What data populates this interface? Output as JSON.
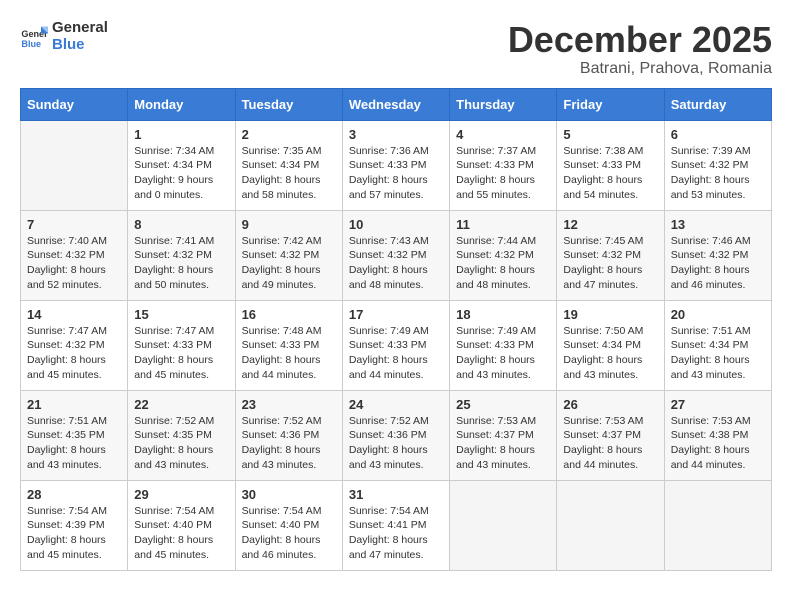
{
  "header": {
    "logo_general": "General",
    "logo_blue": "Blue",
    "month_title": "December 2025",
    "location": "Batrani, Prahova, Romania"
  },
  "days_of_week": [
    "Sunday",
    "Monday",
    "Tuesday",
    "Wednesday",
    "Thursday",
    "Friday",
    "Saturday"
  ],
  "weeks": [
    [
      {
        "day": "",
        "info": ""
      },
      {
        "day": "1",
        "info": "Sunrise: 7:34 AM\nSunset: 4:34 PM\nDaylight: 9 hours\nand 0 minutes."
      },
      {
        "day": "2",
        "info": "Sunrise: 7:35 AM\nSunset: 4:34 PM\nDaylight: 8 hours\nand 58 minutes."
      },
      {
        "day": "3",
        "info": "Sunrise: 7:36 AM\nSunset: 4:33 PM\nDaylight: 8 hours\nand 57 minutes."
      },
      {
        "day": "4",
        "info": "Sunrise: 7:37 AM\nSunset: 4:33 PM\nDaylight: 8 hours\nand 55 minutes."
      },
      {
        "day": "5",
        "info": "Sunrise: 7:38 AM\nSunset: 4:33 PM\nDaylight: 8 hours\nand 54 minutes."
      },
      {
        "day": "6",
        "info": "Sunrise: 7:39 AM\nSunset: 4:32 PM\nDaylight: 8 hours\nand 53 minutes."
      }
    ],
    [
      {
        "day": "7",
        "info": "Sunrise: 7:40 AM\nSunset: 4:32 PM\nDaylight: 8 hours\nand 52 minutes."
      },
      {
        "day": "8",
        "info": "Sunrise: 7:41 AM\nSunset: 4:32 PM\nDaylight: 8 hours\nand 50 minutes."
      },
      {
        "day": "9",
        "info": "Sunrise: 7:42 AM\nSunset: 4:32 PM\nDaylight: 8 hours\nand 49 minutes."
      },
      {
        "day": "10",
        "info": "Sunrise: 7:43 AM\nSunset: 4:32 PM\nDaylight: 8 hours\nand 48 minutes."
      },
      {
        "day": "11",
        "info": "Sunrise: 7:44 AM\nSunset: 4:32 PM\nDaylight: 8 hours\nand 48 minutes."
      },
      {
        "day": "12",
        "info": "Sunrise: 7:45 AM\nSunset: 4:32 PM\nDaylight: 8 hours\nand 47 minutes."
      },
      {
        "day": "13",
        "info": "Sunrise: 7:46 AM\nSunset: 4:32 PM\nDaylight: 8 hours\nand 46 minutes."
      }
    ],
    [
      {
        "day": "14",
        "info": "Sunrise: 7:47 AM\nSunset: 4:32 PM\nDaylight: 8 hours\nand 45 minutes."
      },
      {
        "day": "15",
        "info": "Sunrise: 7:47 AM\nSunset: 4:33 PM\nDaylight: 8 hours\nand 45 minutes."
      },
      {
        "day": "16",
        "info": "Sunrise: 7:48 AM\nSunset: 4:33 PM\nDaylight: 8 hours\nand 44 minutes."
      },
      {
        "day": "17",
        "info": "Sunrise: 7:49 AM\nSunset: 4:33 PM\nDaylight: 8 hours\nand 44 minutes."
      },
      {
        "day": "18",
        "info": "Sunrise: 7:49 AM\nSunset: 4:33 PM\nDaylight: 8 hours\nand 43 minutes."
      },
      {
        "day": "19",
        "info": "Sunrise: 7:50 AM\nSunset: 4:34 PM\nDaylight: 8 hours\nand 43 minutes."
      },
      {
        "day": "20",
        "info": "Sunrise: 7:51 AM\nSunset: 4:34 PM\nDaylight: 8 hours\nand 43 minutes."
      }
    ],
    [
      {
        "day": "21",
        "info": "Sunrise: 7:51 AM\nSunset: 4:35 PM\nDaylight: 8 hours\nand 43 minutes."
      },
      {
        "day": "22",
        "info": "Sunrise: 7:52 AM\nSunset: 4:35 PM\nDaylight: 8 hours\nand 43 minutes."
      },
      {
        "day": "23",
        "info": "Sunrise: 7:52 AM\nSunset: 4:36 PM\nDaylight: 8 hours\nand 43 minutes."
      },
      {
        "day": "24",
        "info": "Sunrise: 7:52 AM\nSunset: 4:36 PM\nDaylight: 8 hours\nand 43 minutes."
      },
      {
        "day": "25",
        "info": "Sunrise: 7:53 AM\nSunset: 4:37 PM\nDaylight: 8 hours\nand 43 minutes."
      },
      {
        "day": "26",
        "info": "Sunrise: 7:53 AM\nSunset: 4:37 PM\nDaylight: 8 hours\nand 44 minutes."
      },
      {
        "day": "27",
        "info": "Sunrise: 7:53 AM\nSunset: 4:38 PM\nDaylight: 8 hours\nand 44 minutes."
      }
    ],
    [
      {
        "day": "28",
        "info": "Sunrise: 7:54 AM\nSunset: 4:39 PM\nDaylight: 8 hours\nand 45 minutes."
      },
      {
        "day": "29",
        "info": "Sunrise: 7:54 AM\nSunset: 4:40 PM\nDaylight: 8 hours\nand 45 minutes."
      },
      {
        "day": "30",
        "info": "Sunrise: 7:54 AM\nSunset: 4:40 PM\nDaylight: 8 hours\nand 46 minutes."
      },
      {
        "day": "31",
        "info": "Sunrise: 7:54 AM\nSunset: 4:41 PM\nDaylight: 8 hours\nand 47 minutes."
      },
      {
        "day": "",
        "info": ""
      },
      {
        "day": "",
        "info": ""
      },
      {
        "day": "",
        "info": ""
      }
    ]
  ]
}
